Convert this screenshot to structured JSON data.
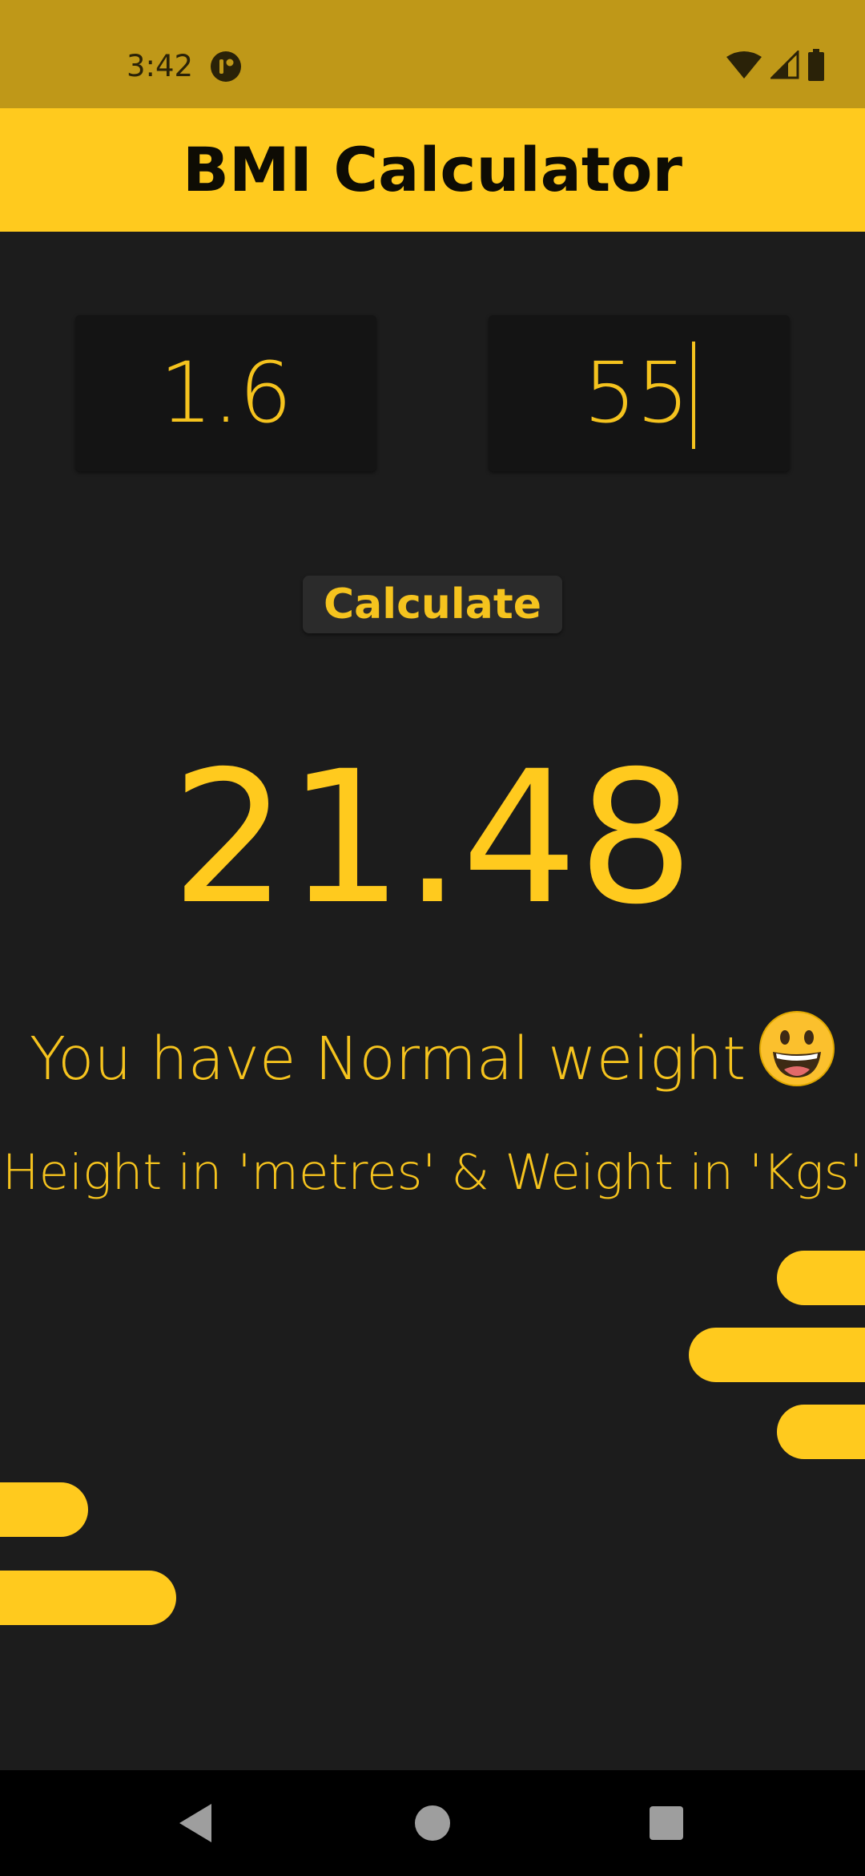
{
  "status_bar": {
    "time": "3:42",
    "icons": [
      "app-notification-icon",
      "wifi-icon",
      "cellular-signal-icon",
      "battery-icon"
    ]
  },
  "app_bar": {
    "title": "BMI Calculator"
  },
  "inputs": {
    "height": {
      "value": "1.6"
    },
    "weight": {
      "value": "55"
    }
  },
  "calculate_button": {
    "label": "Calculate"
  },
  "result": {
    "bmi": "21.48",
    "message": "You have Normal weight",
    "emoji": "grinning-face-emoji",
    "hint": "Height in 'metres' & Weight in 'Kgs'"
  },
  "nav_bar": {
    "icons": [
      "back-icon",
      "home-icon",
      "recents-icon"
    ]
  },
  "colors": {
    "accent": "#ffca1e",
    "text_accent": "#f5c31e",
    "background": "#1c1c1c",
    "status_bar": "#bf9818"
  }
}
